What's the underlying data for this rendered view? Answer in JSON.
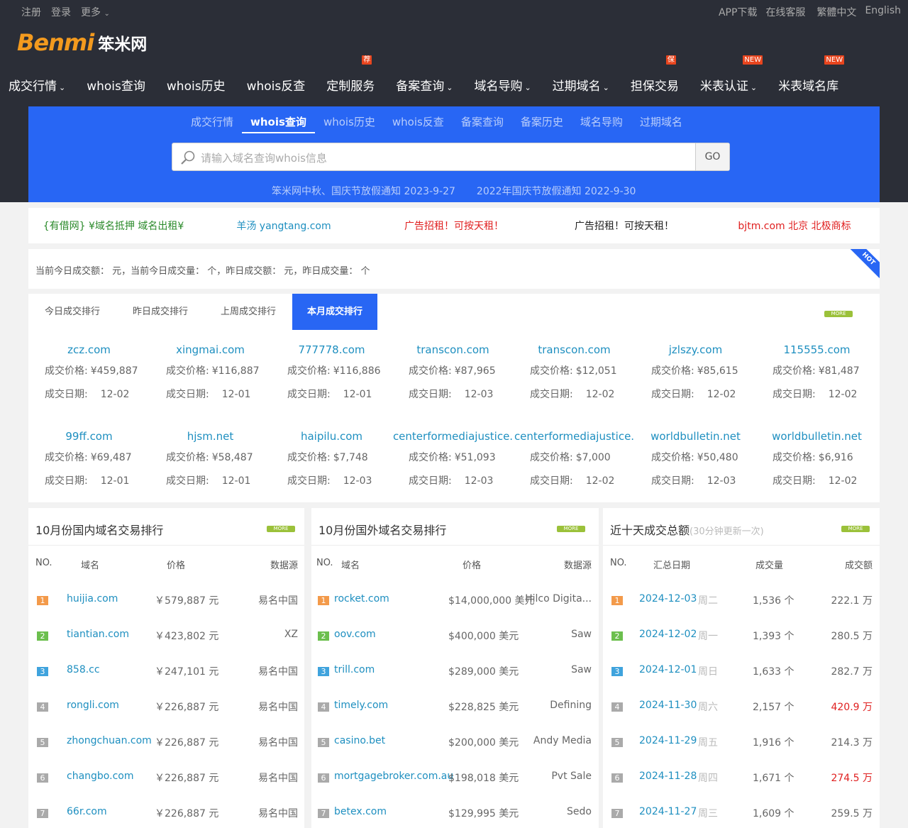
{
  "topbar": {
    "register": "注册",
    "login": "登录",
    "more": "更多",
    "app": "APP下载",
    "service": "在线客服",
    "trad": "繁體中文",
    "english": "English"
  },
  "logo": {
    "en": "Benmi",
    "cn": "笨米网"
  },
  "nav": [
    {
      "label": "成交行情",
      "arrow": true,
      "badge": ""
    },
    {
      "label": "whois查询",
      "arrow": false,
      "badge": ""
    },
    {
      "label": "whois历史",
      "arrow": false,
      "badge": ""
    },
    {
      "label": "whois反查",
      "arrow": false,
      "badge": ""
    },
    {
      "label": "定制服务",
      "arrow": false,
      "badge": "荐"
    },
    {
      "label": "备案查询",
      "arrow": true,
      "badge": ""
    },
    {
      "label": "域名导购",
      "arrow": true,
      "badge": ""
    },
    {
      "label": "过期域名",
      "arrow": true,
      "badge": ""
    },
    {
      "label": "担保交易",
      "arrow": false,
      "badge": "保"
    },
    {
      "label": "米表认证",
      "arrow": true,
      "badge": "NEW"
    },
    {
      "label": "米表域名库",
      "arrow": false,
      "badge": "NEW"
    }
  ],
  "subtabs": [
    "成交行情",
    "whois查询",
    "whois历史",
    "whois反查",
    "备案查询",
    "备案历史",
    "域名导购",
    "过期域名"
  ],
  "search": {
    "placeholder": "请输入域名查询whois信息",
    "go": "GO"
  },
  "notices": [
    "笨米网中秋、国庆节放假通知 2023-9-27",
    "2022年国庆节放假通知 2022-9-30"
  ],
  "ads": [
    {
      "text": "{有借网} ¥域名抵押 域名出租¥",
      "color": "#2a8a2a"
    },
    {
      "text": "羊汤 yangtang.com",
      "color": "#1e8fc0"
    },
    {
      "text": "广告招租！可按天租！",
      "color": "#e02020"
    },
    {
      "text": "广告招租！可按天租！",
      "color": "#222222"
    },
    {
      "text": "bjtm.com 北京 北极商标",
      "color": "#e02020"
    }
  ],
  "stats": {
    "text": "当前今日成交额：  元，当前今日成交量：  个，昨日成交额：  元，昨日成交量：  个",
    "hot": "HOT"
  },
  "rank": {
    "tabs": [
      "今日成交排行",
      "昨日成交排行",
      "上周成交排行",
      "本月成交排行"
    ],
    "more": "MORE",
    "price_label": "成交价格:",
    "date_label": "成交日期:",
    "items": [
      {
        "domain": "zcz.com",
        "price": "¥459,887",
        "date": "12-02"
      },
      {
        "domain": "xingmai.com",
        "price": "¥116,887",
        "date": "12-01"
      },
      {
        "domain": "777778.com",
        "price": "¥116,886",
        "date": "12-01"
      },
      {
        "domain": "transcon.com",
        "price": "¥87,965",
        "date": "12-03"
      },
      {
        "domain": "transcon.com",
        "price": "$12,051",
        "date": "12-02"
      },
      {
        "domain": "jzlszy.com",
        "price": "¥85,615",
        "date": "12-02"
      },
      {
        "domain": "115555.com",
        "price": "¥81,487",
        "date": "12-02"
      },
      {
        "domain": "99ff.com",
        "price": "¥69,487",
        "date": "12-01"
      },
      {
        "domain": "hjsm.net",
        "price": "¥58,487",
        "date": "12-01"
      },
      {
        "domain": "haipilu.com",
        "price": "$7,748",
        "date": "12-03"
      },
      {
        "domain": "centerformediajustice.",
        "price": "¥51,093",
        "date": "12-03"
      },
      {
        "domain": "centerformediajustice.",
        "price": "$7,000",
        "date": "12-02"
      },
      {
        "domain": "worldbulletin.net",
        "price": "¥50,480",
        "date": "12-03"
      },
      {
        "domain": "worldbulletin.net",
        "price": "$6,916",
        "date": "12-02"
      }
    ]
  },
  "domestic": {
    "title": "10月份国内域名交易排行",
    "cols": [
      "NO.",
      "域名",
      "价格",
      "数据源"
    ],
    "rows": [
      {
        "n": "1",
        "domain": "huijia.com",
        "price": "￥579,887 元",
        "src": "易名中国"
      },
      {
        "n": "2",
        "domain": "tiantian.com",
        "price": "￥423,802 元",
        "src": "XZ"
      },
      {
        "n": "3",
        "domain": "858.cc",
        "price": "￥247,101 元",
        "src": "易名中国"
      },
      {
        "n": "4",
        "domain": "rongli.com",
        "price": "￥226,887 元",
        "src": "易名中国"
      },
      {
        "n": "5",
        "domain": "zhongchuan.com",
        "price": "￥226,887 元",
        "src": "易名中国"
      },
      {
        "n": "6",
        "domain": "changbo.com",
        "price": "￥226,887 元",
        "src": "易名中国"
      },
      {
        "n": "7",
        "domain": "66r.com",
        "price": "￥226,887 元",
        "src": "易名中国"
      }
    ]
  },
  "foreign": {
    "title": "10月份国外域名交易排行",
    "cols": [
      "NO.",
      "域名",
      "价格",
      "数据源"
    ],
    "rows": [
      {
        "n": "1",
        "domain": "rocket.com",
        "price": "$14,000,000 美元",
        "src": "Hilco Digita..."
      },
      {
        "n": "2",
        "domain": "oov.com",
        "price": "$400,000 美元",
        "src": "Saw"
      },
      {
        "n": "3",
        "domain": "trill.com",
        "price": "$289,000 美元",
        "src": "Saw"
      },
      {
        "n": "4",
        "domain": "timely.com",
        "price": "$228,825 美元",
        "src": "Defining"
      },
      {
        "n": "5",
        "domain": "casino.bet",
        "price": "$200,000 美元",
        "src": "Andy Media"
      },
      {
        "n": "6",
        "domain": "mortgagebroker.com.au",
        "price": "$198,018 美元",
        "src": "Pvt Sale"
      },
      {
        "n": "7",
        "domain": "betex.com",
        "price": "$129,995 美元",
        "src": "Sedo"
      }
    ]
  },
  "summary": {
    "title": "近十天成交总额",
    "subtitle": "(30分钟更新一次)",
    "cols": [
      "NO.",
      "汇总日期",
      "成交量",
      "成交额"
    ],
    "rows": [
      {
        "n": "1",
        "date": "2024-12-03",
        "week": "周二",
        "count": "1,536 个",
        "amount": "222.1 万",
        "hl": false
      },
      {
        "n": "2",
        "date": "2024-12-02",
        "week": "周一",
        "count": "1,393 个",
        "amount": "280.5 万",
        "hl": false
      },
      {
        "n": "3",
        "date": "2024-12-01",
        "week": "周日",
        "count": "1,633 个",
        "amount": "282.7 万",
        "hl": false
      },
      {
        "n": "4",
        "date": "2024-11-30",
        "week": "周六",
        "count": "2,157 个",
        "amount": "420.9 万",
        "hl": true
      },
      {
        "n": "5",
        "date": "2024-11-29",
        "week": "周五",
        "count": "1,916 个",
        "amount": "214.3 万",
        "hl": false
      },
      {
        "n": "6",
        "date": "2024-11-28",
        "week": "周四",
        "count": "1,671 个",
        "amount": "274.5 万",
        "hl": true
      },
      {
        "n": "7",
        "date": "2024-11-27",
        "week": "周三",
        "count": "1,609 个",
        "amount": "259.5 万",
        "hl": false
      }
    ]
  },
  "colors": {
    "accent": "#2866f4",
    "dark": "#2b2e37",
    "link": "#1e8fc0",
    "rank1": "#f39a4a",
    "rank2": "#6cbf4e",
    "rank3": "#3fa3dd",
    "rankN": "#aaaaaa"
  }
}
